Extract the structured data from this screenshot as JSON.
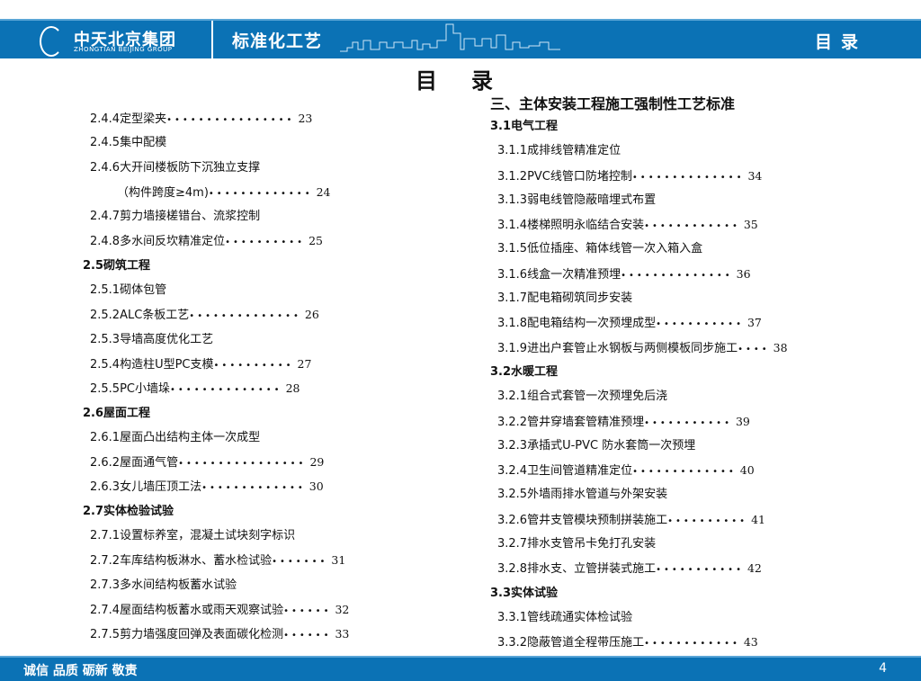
{
  "header": {
    "company_cn": "中天北京集团",
    "company_en": "ZHONGTIAN BEIJING GROUP",
    "title": "标准化工艺",
    "section": "目录"
  },
  "page_title": "目录",
  "left": [
    {
      "text": "2.4.4定型梁夹",
      "dots": "••••••••••••••••",
      "page": "23"
    },
    {
      "text": "2.4.5集中配模"
    },
    {
      "text": "2.4.6大开间楼板防下沉独立支撑"
    },
    {
      "text": "（构件跨度≥4m)",
      "dots": "•••••••••••••",
      "page": "24",
      "indent": true
    },
    {
      "text": "2.4.7剪力墙接槎错台、流浆控制"
    },
    {
      "text": "2.4.8多水间反坎精准定位",
      "dots": "••••••••••",
      "page": "25"
    },
    {
      "text": "2.5砌筑工程",
      "sec": true
    },
    {
      "text": "2.5.1砌体包管"
    },
    {
      "text": "2.5.2ALC条板工艺",
      "dots": "••••••••••••••",
      "page": "26"
    },
    {
      "text": "2.5.3导墙高度优化工艺"
    },
    {
      "text": "2.5.4构造柱U型PC支模",
      "dots": "••••••••••",
      "page": "27"
    },
    {
      "text": "2.5.5PC小墙垛",
      "dots": "••••••••••••••",
      "page": "28"
    },
    {
      "text": "2.6屋面工程",
      "sec": true
    },
    {
      "text": "2.6.1屋面凸出结构主体一次成型"
    },
    {
      "text": "2.6.2屋面通气管",
      "dots": "••••••••••••••••",
      "page": "29"
    },
    {
      "text": "2.6.3女儿墙压顶工法",
      "dots": "•••••••••••••",
      "page": "30"
    },
    {
      "text": "2.7实体检验试验",
      "sec": true
    },
    {
      "text": "2.7.1设置标养室，混凝土试块刻字标识"
    },
    {
      "text": "2.7.2车库结构板淋水、蓄水检试验",
      "dots": "•••••••",
      "page": "31"
    },
    {
      "text": "2.7.3多水间结构板蓄水试验"
    },
    {
      "text": "2.7.4屋面结构板蓄水或雨天观察试验",
      "dots": "••••••",
      "page": "32"
    },
    {
      "text": "2.7.5剪力墙强度回弹及表面碳化检测",
      "dots": "••••••",
      "page": "33"
    }
  ],
  "right_title": "三、主体安装工程施工强制性工艺标准",
  "right": [
    {
      "text": "3.1电气工程",
      "sec": true
    },
    {
      "text": "3.1.1成排线管精准定位"
    },
    {
      "text": "3.1.2PVC线管口防堵控制",
      "dots": "••••••••••••••",
      "page": "34"
    },
    {
      "text": "3.1.3弱电线管隐蔽暗埋式布置"
    },
    {
      "text": "3.1.4楼梯照明永临结合安装",
      "dots": "••••••••••••",
      "page": "35"
    },
    {
      "text": "3.1.5低位插座、箱体线管一次入箱入盒"
    },
    {
      "text": "3.1.6线盒一次精准预埋",
      "dots": "••••••••••••••",
      "page": "36"
    },
    {
      "text": "3.1.7配电箱砌筑同步安装"
    },
    {
      "text": "3.1.8配电箱结构一次预埋成型",
      "dots": "•••••••••••",
      "page": "37"
    },
    {
      "text": "3.1.9进出户套管止水钢板与两侧模板同步施工",
      "dots": "••••",
      "page": "38"
    },
    {
      "text": "3.2水暖工程",
      "sec": true
    },
    {
      "text": "3.2.1组合式套管一次预埋免后浇"
    },
    {
      "text": "3.2.2管井穿墙套管精准预埋",
      "dots": "•••••••••••",
      "page": "39"
    },
    {
      "text": "3.2.3承插式U-PVC 防水套筒一次预埋"
    },
    {
      "text": "3.2.4卫生间管道精准定位",
      "dots": "•••••••••••••",
      "page": "40"
    },
    {
      "text": "3.2.5外墙雨排水管道与外架安装"
    },
    {
      "text": "3.2.6管井支管模块预制拼装施工",
      "dots": "••••••••••",
      "page": "41"
    },
    {
      "text": "3.2.7排水支管吊卡免打孔安装"
    },
    {
      "text": "3.2.8排水支、立管拼装式施工",
      "dots": "•••••••••••",
      "page": "42"
    },
    {
      "text": "3.3实体试验",
      "sec": true
    },
    {
      "text": "3.3.1管线疏通实体检试验"
    },
    {
      "text": "3.3.2隐蔽管道全程带压施工",
      "dots": "••••••••••••",
      "page": "43"
    }
  ],
  "footer": {
    "slogan": "诚信 品质 砺新 敬责",
    "page_number": "4"
  }
}
